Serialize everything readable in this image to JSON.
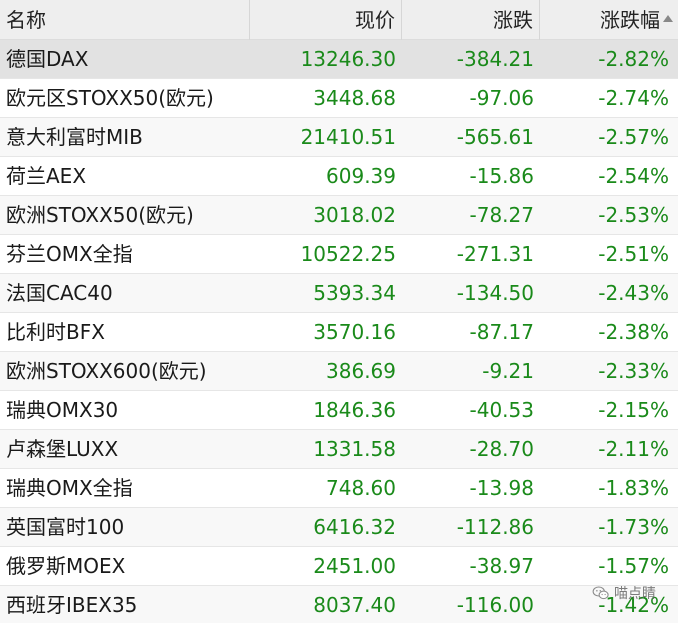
{
  "header": {
    "name": "名称",
    "price": "现价",
    "change": "涨跌",
    "change_pct": "涨跌幅"
  },
  "rows": [
    {
      "name": "德国DAX",
      "price": "13246.30",
      "change": "-384.21",
      "change_pct": "-2.82%"
    },
    {
      "name": "欧元区STOXX50(欧元)",
      "price": "3448.68",
      "change": "-97.06",
      "change_pct": "-2.74%"
    },
    {
      "name": "意大利富时MIB",
      "price": "21410.51",
      "change": "-565.61",
      "change_pct": "-2.57%"
    },
    {
      "name": "荷兰AEX",
      "price": "609.39",
      "change": "-15.86",
      "change_pct": "-2.54%"
    },
    {
      "name": "欧洲STOXX50(欧元)",
      "price": "3018.02",
      "change": "-78.27",
      "change_pct": "-2.53%"
    },
    {
      "name": "芬兰OMX全指",
      "price": "10522.25",
      "change": "-271.31",
      "change_pct": "-2.51%"
    },
    {
      "name": "法国CAC40",
      "price": "5393.34",
      "change": "-134.50",
      "change_pct": "-2.43%"
    },
    {
      "name": "比利时BFX",
      "price": "3570.16",
      "change": "-87.17",
      "change_pct": "-2.38%"
    },
    {
      "name": "欧洲STOXX600(欧元)",
      "price": "386.69",
      "change": "-9.21",
      "change_pct": "-2.33%"
    },
    {
      "name": "瑞典OMX30",
      "price": "1846.36",
      "change": "-40.53",
      "change_pct": "-2.15%"
    },
    {
      "name": "卢森堡LUXX",
      "price": "1331.58",
      "change": "-28.70",
      "change_pct": "-2.11%"
    },
    {
      "name": "瑞典OMX全指",
      "price": "748.60",
      "change": "-13.98",
      "change_pct": "-1.83%"
    },
    {
      "name": "英国富时100",
      "price": "6416.32",
      "change": "-112.86",
      "change_pct": "-1.73%"
    },
    {
      "name": "俄罗斯MOEX",
      "price": "2451.00",
      "change": "-38.97",
      "change_pct": "-1.57%"
    },
    {
      "name": "西班牙IBEX35",
      "price": "8037.40",
      "change": "-116.00",
      "change_pct": "-1.42%"
    }
  ],
  "watermark": {
    "text": "喵点睛",
    "icon": "wechat-icon"
  },
  "colors": {
    "negative": "#1a8a1a",
    "header_bg": "#eeeeee",
    "selected_row_bg": "#e2e2e2"
  }
}
